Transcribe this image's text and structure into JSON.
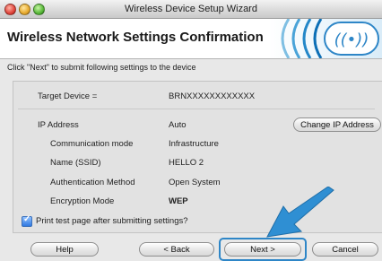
{
  "window": {
    "title": "Wireless Device Setup Wizard"
  },
  "header": {
    "title": "Wireless Network Settings Confirmation"
  },
  "instruction": "Click \"Next\" to submit following settings to the device",
  "target": {
    "label": "Target Device =",
    "value": "BRNXXXXXXXXXXXX"
  },
  "settings": [
    {
      "label": "IP Address",
      "value": "Auto"
    },
    {
      "label": "Communication mode",
      "value": "Infrastructure"
    },
    {
      "label": "Name (SSID)",
      "value": "HELLO 2"
    },
    {
      "label": "Authentication Method",
      "value": "Open System"
    },
    {
      "label": "Encryption Mode",
      "value": "WEP"
    }
  ],
  "buttons": {
    "change_ip": "Change IP Address",
    "help": "Help",
    "back": "< Back",
    "next": "Next >",
    "cancel": "Cancel"
  },
  "checkbox": {
    "label": "Print test page after submitting settings?",
    "checked": true
  },
  "colors": {
    "arrow": "#2f8fd3",
    "highlight": "#2e86c7"
  }
}
